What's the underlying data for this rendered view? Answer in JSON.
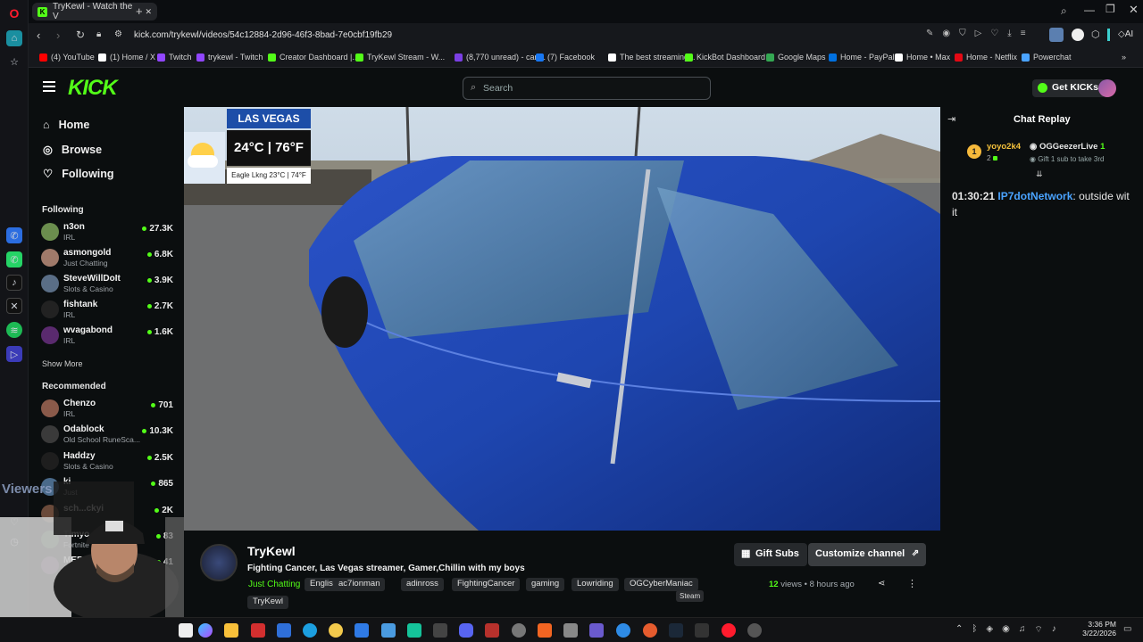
{
  "browser": {
    "tab_title": "TryKewl - Watch the V",
    "url": "kick.com/trykewl/videos/54c12884-2d96-46f3-8bad-7e0cbf19fb29",
    "ai_label": "AI"
  },
  "bookmarks": [
    {
      "label": "(4) YouTube",
      "color": "#ff0000"
    },
    {
      "label": "(1) Home / X",
      "color": "#ffffff"
    },
    {
      "label": "Twitch",
      "color": "#9146ff"
    },
    {
      "label": "trykewl - Twitch",
      "color": "#9146ff"
    },
    {
      "label": "Creator Dashboard |...",
      "color": "#53fc18"
    },
    {
      "label": "TryKewl Stream - W...",
      "color": "#53fc18"
    },
    {
      "label": "(8,770 unread) - carl...",
      "color": "#7b3fe4"
    },
    {
      "label": "(7) Facebook",
      "color": "#1877f2"
    },
    {
      "label": "The best streaming...",
      "color": "#ffffff"
    },
    {
      "label": "KickBot Dashboard",
      "color": "#53fc18"
    },
    {
      "label": "Google Maps",
      "color": "#34a853"
    },
    {
      "label": "Home - PayPal",
      "color": "#0070e0"
    },
    {
      "label": "Home • Max",
      "color": "#ffffff"
    },
    {
      "label": "Home - Netflix",
      "color": "#e50914"
    },
    {
      "label": "Powerchat",
      "color": "#4aa3ff"
    }
  ],
  "kick": {
    "logo": "KICK",
    "search_placeholder": "Search",
    "get_kicks": "Get KICKs"
  },
  "nav": {
    "home": "Home",
    "browse": "Browse",
    "following": "Following",
    "following_title": "Following",
    "show_more": "Show More",
    "recommended_title": "Recommended",
    "overlay_text": "Viewers"
  },
  "following": [
    {
      "name": "n3on",
      "category": "IRL",
      "viewers": "27.3K",
      "color": "#6b8e4e"
    },
    {
      "name": "asmongold",
      "category": "Just Chatting",
      "viewers": "6.8K",
      "color": "#a07a6a"
    },
    {
      "name": "SteveWillDoIt",
      "category": "Slots & Casino",
      "viewers": "3.9K",
      "color": "#5a6e86"
    },
    {
      "name": "fishtank",
      "category": "IRL",
      "viewers": "2.7K",
      "color": "#222222"
    },
    {
      "name": "wvagabond",
      "category": "IRL",
      "viewers": "1.6K",
      "color": "#5a2a6e"
    }
  ],
  "recommended": [
    {
      "name": "Chenzo",
      "category": "IRL",
      "viewers": "701",
      "color": "#8a5a4a"
    },
    {
      "name": "Odablock",
      "category": "Old School RuneSca...",
      "viewers": "10.3K",
      "color": "#3a3a3a"
    },
    {
      "name": "Haddzy",
      "category": "Slots & Casino",
      "viewers": "2.5K",
      "color": "#1e1e1e"
    },
    {
      "name": "ki",
      "category": "Just",
      "viewers": "865",
      "color": "#4a6a8a"
    },
    {
      "name": "sch...ckyi",
      "category": "",
      "viewers": "2K",
      "color": "#6a4a3a"
    },
    {
      "name": "Timyo...",
      "category": "Fortnite",
      "viewers": "83",
      "color": "#3a5a3a"
    },
    {
      "name": "MERPTO",
      "category": "Crim...",
      "viewers": "41",
      "color": "#5a3a5a"
    }
  ],
  "video": {
    "weather_city": "LAS VEGAS",
    "weather_temp": "24°C | 76°F",
    "weather_sub": "Eagle Lkng 23°C | 74°F"
  },
  "info": {
    "channel": "TryKewl",
    "title": "Fighting Cancer, Las Vegas streamer, Gamer,Chillin with my boys",
    "category": "Just Chatting",
    "tags": [
      "English",
      "ac7ionman",
      "adinross",
      "FightingCancer",
      "gaming",
      "Lowriding",
      "OGCyberManiac"
    ],
    "extra_tag": "TryKewl",
    "gift_subs": "Gift Subs",
    "customize": "Customize channel",
    "views_num": "12",
    "views_word": "views",
    "time_ago": "8 hours ago",
    "tooltip": "Steam"
  },
  "chat": {
    "title": "Chat Replay",
    "leader1_name": "yoyo2k4",
    "leader1_count": "2",
    "leader2_name": "OGGeezerLive",
    "leader2_count": "1",
    "leader_sub": "Gift 1 sub to take 3rd",
    "msg_time": "01:30:21",
    "msg_user": "IP7dotNetwork",
    "msg_text": ": outside wit it"
  },
  "taskbar": {
    "time": "3:36 PM",
    "date": "3/22/2026"
  },
  "colors": {
    "kick_green": "#53fc18",
    "bg": "#0b0e0f",
    "chat_user": "#4aa3ff"
  }
}
